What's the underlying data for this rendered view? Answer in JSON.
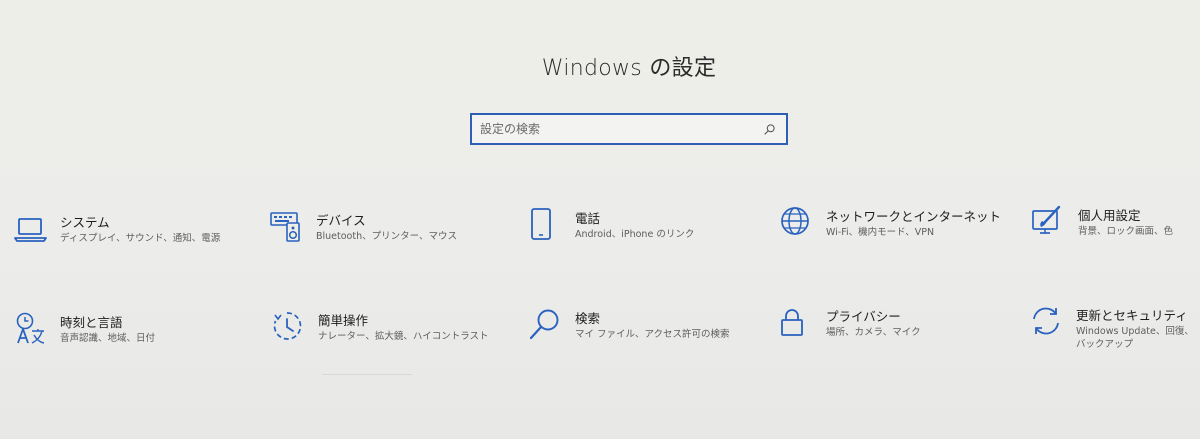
{
  "window": {
    "title": "Windows の設定"
  },
  "search": {
    "placeholder": "設定の検索"
  },
  "colors": {
    "accent": "#2f5fb5",
    "icon": "#2a62bf"
  },
  "tiles": [
    {
      "icon": "laptop-icon",
      "name": "システム",
      "desc": "ディスプレイ、サウンド、通知、電源"
    },
    {
      "icon": "keyboard-speaker-icon",
      "name": "デバイス",
      "desc": "Bluetooth、プリンター、マウス"
    },
    {
      "icon": "phone-icon",
      "name": "電話",
      "desc": "Android、iPhone のリンク"
    },
    {
      "icon": "globe-icon",
      "name": "ネットワークとインターネット",
      "desc": "Wi-Fi、機内モード、VPN"
    },
    {
      "icon": "paint-brush-icon",
      "name": "個人用設定",
      "desc": "背景、ロック画面、色"
    },
    {
      "icon": "time-language-icon",
      "name": "時刻と言語",
      "desc": "音声認識、地域、日付"
    },
    {
      "icon": "ease-of-access-icon",
      "name": "簡単操作",
      "desc": "ナレーター、拡大鏡、ハイコントラスト"
    },
    {
      "icon": "search-icon",
      "name": "検索",
      "desc": "マイ ファイル、アクセス許可の検索"
    },
    {
      "icon": "lock-icon",
      "name": "プライバシー",
      "desc": "場所、カメラ、マイク"
    },
    {
      "icon": "sync-icon",
      "name": "更新とセキュリティ",
      "desc": "Windows Update、回復、バックアップ"
    }
  ]
}
